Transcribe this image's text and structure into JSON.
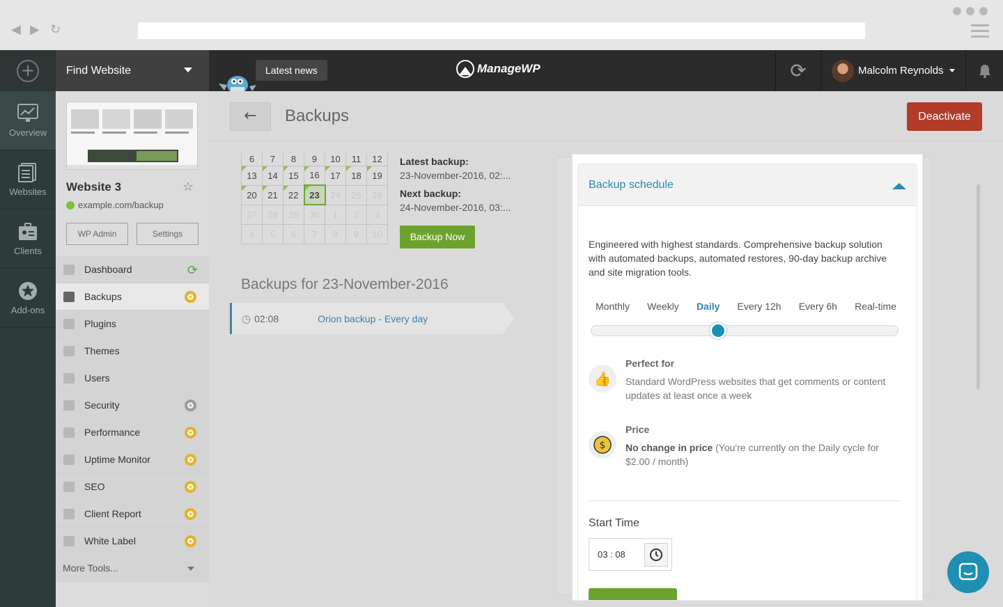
{
  "browser": {
    "url": ""
  },
  "topbar": {
    "find_website": "Find Website",
    "latest_news": "Latest news",
    "logo_text": "ManageWP",
    "user_name": "Malcolm Reynolds"
  },
  "rail": {
    "items": [
      {
        "label": "Overview",
        "icon": "monitor-icon"
      },
      {
        "label": "Websites",
        "icon": "pages-icon"
      },
      {
        "label": "Clients",
        "icon": "id-card-icon"
      },
      {
        "label": "Add-ons",
        "icon": "star-badge-icon"
      }
    ]
  },
  "site": {
    "name": "Website 3",
    "url": "example.com/backup",
    "wp_admin": "WP Admin",
    "settings": "Settings"
  },
  "menu": {
    "items": [
      {
        "label": "Dashboard",
        "badge": "refresh"
      },
      {
        "label": "Backups",
        "badge": "gear-gold"
      },
      {
        "label": "Plugins",
        "badge": ""
      },
      {
        "label": "Themes",
        "badge": ""
      },
      {
        "label": "Users",
        "badge": ""
      },
      {
        "label": "Security",
        "badge": "gear-grey"
      },
      {
        "label": "Performance",
        "badge": "gear-gold"
      },
      {
        "label": "Uptime Monitor",
        "badge": "gear-gold"
      },
      {
        "label": "SEO",
        "badge": "gear-gold"
      },
      {
        "label": "Client Report",
        "badge": "gear-gold"
      },
      {
        "label": "White Label",
        "badge": "gear-gold"
      }
    ],
    "more_tools": "More Tools..."
  },
  "main": {
    "title": "Backups",
    "deactivate": "Deactivate",
    "calendar": {
      "rows": [
        [
          "6",
          "7",
          "8",
          "9",
          "10",
          "11",
          "12"
        ],
        [
          "13",
          "14",
          "15",
          "16",
          "17",
          "18",
          "19"
        ],
        [
          "20",
          "21",
          "22",
          "23",
          "24",
          "25",
          "26"
        ],
        [
          "27",
          "28",
          "29",
          "30",
          "1",
          "2",
          "3"
        ],
        [
          "4",
          "5",
          "6",
          "7",
          "8",
          "9",
          "10"
        ]
      ],
      "today": "23"
    },
    "latest_backup_label": "Latest backup:",
    "latest_backup_value": "23-November-2016, 02:...",
    "next_backup_label": "Next backup:",
    "next_backup_value": "24-November-2016, 03:...",
    "backup_now": "Backup Now",
    "backups_for": "Backups for 23-November-2016",
    "backup_row": {
      "time": "02:08",
      "name": "Orion backup - Every day"
    }
  },
  "modal": {
    "title": "Backup schedule",
    "description": "Engineered with highest standards. Comprehensive backup solution with automated backups, automated restores, 90-day backup archive and site migration tools.",
    "frequencies": [
      "Monthly",
      "Weekly",
      "Daily",
      "Every 12h",
      "Every 6h",
      "Real-time"
    ],
    "selected_frequency": "Daily",
    "slider_position": 0.414,
    "perfect_for_title": "Perfect for",
    "perfect_for_text": "Standard WordPress websites that get comments or content updates at least once a week",
    "price_title": "Price",
    "price_bold": "No change in price",
    "price_text": " (You're currently on the Daily cycle for $2.00 / month)",
    "start_time_label": "Start Time",
    "start_time_value": "03 : 08"
  },
  "colors": {
    "accent": "#2a8ab4",
    "green": "#6ca32f",
    "danger": "#b23b2a"
  }
}
